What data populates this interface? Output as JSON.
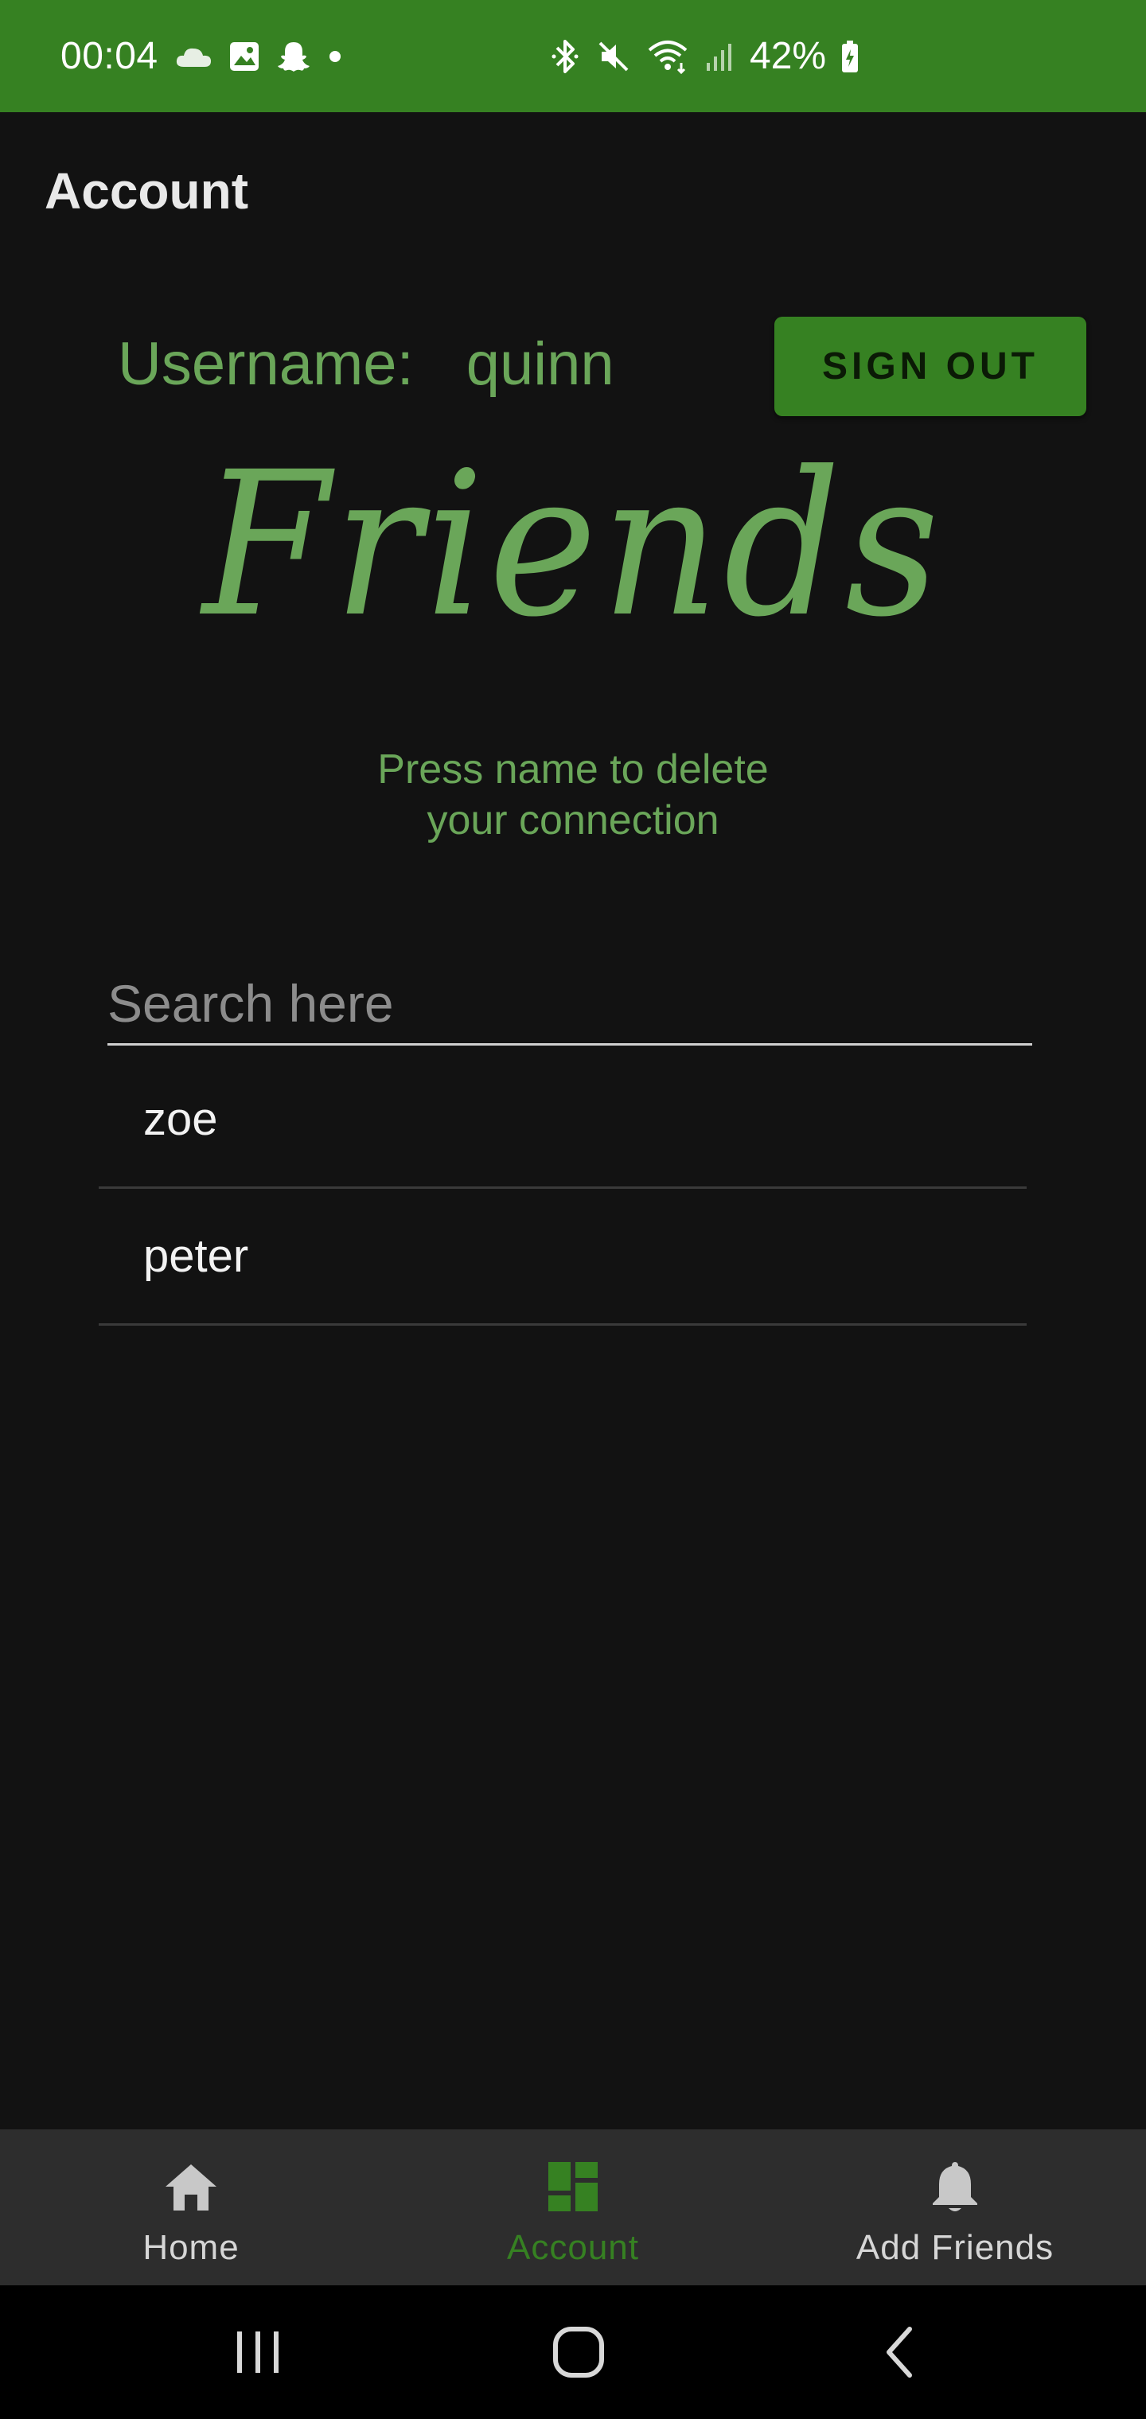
{
  "status_bar": {
    "time": "00:04",
    "battery": "42%",
    "left_icons": [
      "cloud-icon",
      "gallery-icon",
      "snapchat-icon",
      "dot-icon"
    ],
    "right_icons": [
      "bluetooth-icon",
      "mute-icon",
      "wifi-icon",
      "signal-icon",
      "battery-icon"
    ],
    "background_color": "#368122"
  },
  "app_bar": {
    "title": "Account"
  },
  "account": {
    "username_label": "Username:",
    "username_value": "quinn",
    "sign_out_label": "SIGN OUT"
  },
  "friends": {
    "heading": "Friends",
    "instruction_line1": "Press name to delete",
    "instruction_line2": "your connection",
    "search_placeholder": "Search here",
    "search_value": "",
    "items": [
      {
        "name": "zoe"
      },
      {
        "name": "peter"
      }
    ]
  },
  "bottom_nav": {
    "items": [
      {
        "label": "Home",
        "icon": "home-icon",
        "active": false
      },
      {
        "label": "Account",
        "icon": "dashboard-icon",
        "active": true
      },
      {
        "label": "Add Friends",
        "icon": "bell-icon",
        "active": false
      }
    ]
  },
  "system_nav": {
    "buttons": [
      "recents-icon",
      "home-circle-icon",
      "back-icon"
    ]
  },
  "colors": {
    "accent": "#368122",
    "text_green": "#6aa659",
    "background": "#121212",
    "nav_background": "#2d2d2d"
  }
}
